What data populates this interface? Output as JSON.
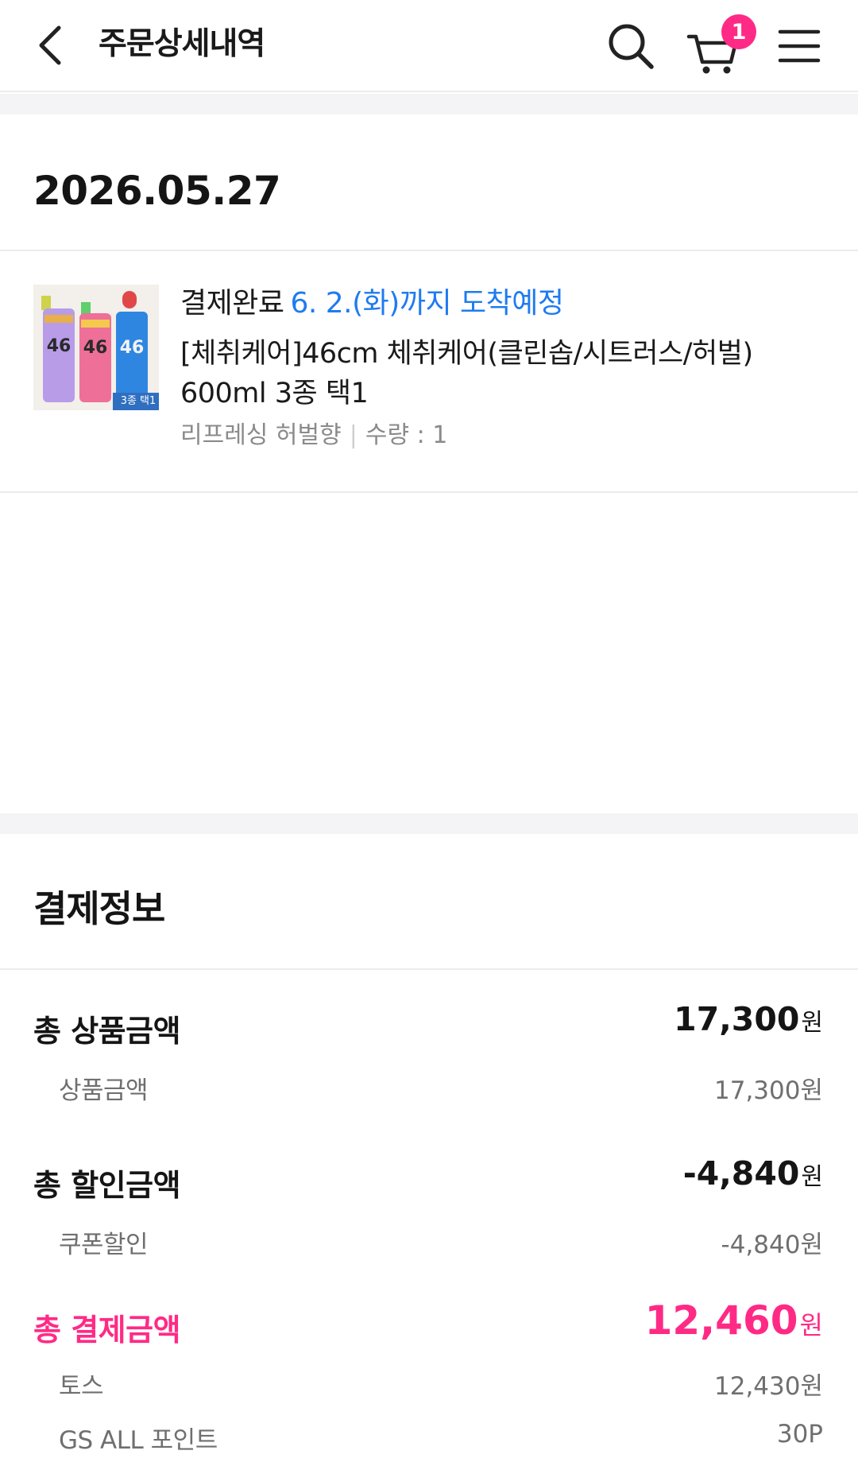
{
  "header": {
    "title": "주문상세내역",
    "cart_count": "1"
  },
  "order": {
    "date": "2026.05.27",
    "status": "결제완료",
    "eta": "6. 2.(화)까지 도착예정",
    "product_name": "[체취케어]46cm 체취케어(클린솝/시트러스/허벌) 600ml 3종 택1",
    "option": "리프레싱 허벌향",
    "separator": "|",
    "quantity": "수량 : 1",
    "thumbnail": {
      "top_label": "3종 택1",
      "bottle_text": "46cm",
      "bottle_colors": [
        "#b79be6",
        "#ee6f98",
        "#2f86e0"
      ]
    }
  },
  "payment": {
    "title": "결제정보",
    "unit": "원",
    "total_product": {
      "label": "총 상품금액",
      "amount": "17,300"
    },
    "product_amount": {
      "label": "상품금액",
      "amount": "17,300원"
    },
    "total_discount": {
      "label": "총 할인금액",
      "amount": "-4,840"
    },
    "coupon_discount": {
      "label": "쿠폰할인",
      "amount": "-4,840원"
    },
    "total_payment": {
      "label": "총 결제금액",
      "amount": "12,460"
    },
    "toss": {
      "label": "토스",
      "amount": "12,430원"
    },
    "gs_point": {
      "label": "GS ALL 포인트",
      "amount": "30P"
    }
  },
  "colors": {
    "accent_pink": "#ff2a86",
    "eta_blue": "#1f7bf0",
    "background_gap": "#f4f4f6"
  },
  "icons": [
    "chevron-left-icon",
    "search-icon",
    "cart-icon",
    "hamburger-menu-icon"
  ]
}
